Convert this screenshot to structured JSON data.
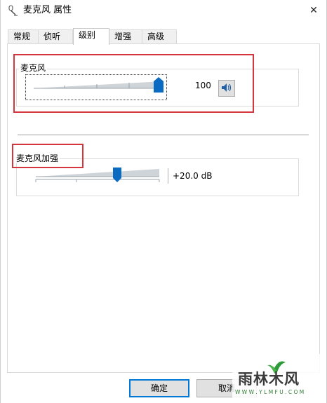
{
  "window": {
    "title": "麦克风 属性",
    "close_glyph": "✕"
  },
  "tabs": [
    {
      "label": "常规",
      "active": false
    },
    {
      "label": "侦听",
      "active": false
    },
    {
      "label": "级别",
      "active": true
    },
    {
      "label": "增强",
      "active": false
    },
    {
      "label": "高级",
      "active": false
    }
  ],
  "microphone": {
    "label": "麦克风",
    "value_text": "100",
    "level": 100,
    "mute_icon": "speaker-icon"
  },
  "boost": {
    "label": "麦克风加强",
    "value_text": "+20.0 dB",
    "level_fraction": 0.67
  },
  "buttons": {
    "ok": "确定",
    "cancel": "取消"
  },
  "watermark": {
    "brand": "雨林木风",
    "url": "W W W . Y L M F U . C O M"
  },
  "colors": {
    "highlight_box": "#d5363e",
    "slider_thumb": "#0b6ac2",
    "default_button_border": "#0078d7"
  }
}
